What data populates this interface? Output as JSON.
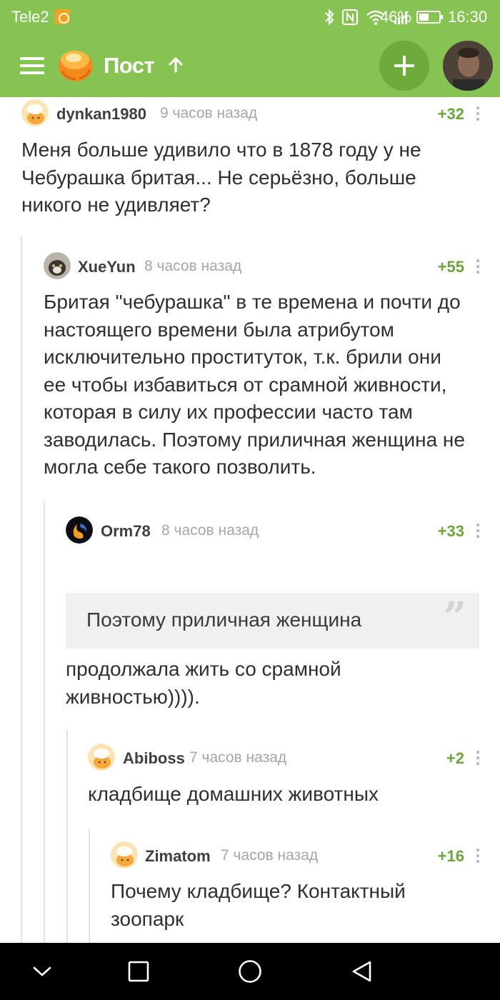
{
  "status_bar": {
    "carrier": "Tele2",
    "battery_percent": "46%",
    "time": "16:30",
    "icons": [
      "bluetooth-icon",
      "nfc-icon",
      "wifi-icon",
      "signal-icon",
      "battery-icon"
    ]
  },
  "app_bar": {
    "title": "Пост",
    "icons": [
      "menu-icon",
      "pikabu-logo",
      "arrow-up-icon",
      "plus-icon"
    ],
    "colors": {
      "bar": "#86c352",
      "add_button": "#6eaa3c"
    }
  },
  "comments": [
    {
      "author": "dynkan1980",
      "time": "9 часов назад",
      "rating": "+32",
      "text_lines": [
        "Меня больше удивило что в 1878 году у не",
        "Чебурашка бритая... Не серьёзно, больше",
        "никого не удивляет?"
      ]
    },
    {
      "author": "XueYun",
      "time": "8 часов назад",
      "rating": "+55",
      "text_lines": [
        "Бритая \"чебурашка\" в те времена и почти до",
        "настоящего времени была атрибутом",
        "исключительно проституток, т.к. брили они",
        "ее чтобы избавиться от срамной живности,",
        "которая в силу их профессии часто там",
        "заводилась. Поэтому приличная женщина не",
        "могла себе такого позволить."
      ]
    },
    {
      "author": "Orm78",
      "time": "8 часов назад",
      "rating": "+33",
      "quote": "Поэтому приличная женщина",
      "text_lines": [
        "продолжала жить со срамной",
        "живностью))))."
      ]
    },
    {
      "author": "Abiboss",
      "time": "7 часов назад",
      "rating": "+2",
      "text_lines": [
        "кладбище домашних животных"
      ]
    },
    {
      "author": "Zimatom",
      "time": "7 часов назад",
      "rating": "+16",
      "text_lines": [
        "Почему кладбище? Контактный",
        "зоопарк"
      ]
    }
  ],
  "colors": {
    "rating": "#6aa63a",
    "time": "#a6a6a6",
    "thread_line": "#e2e2e2"
  }
}
